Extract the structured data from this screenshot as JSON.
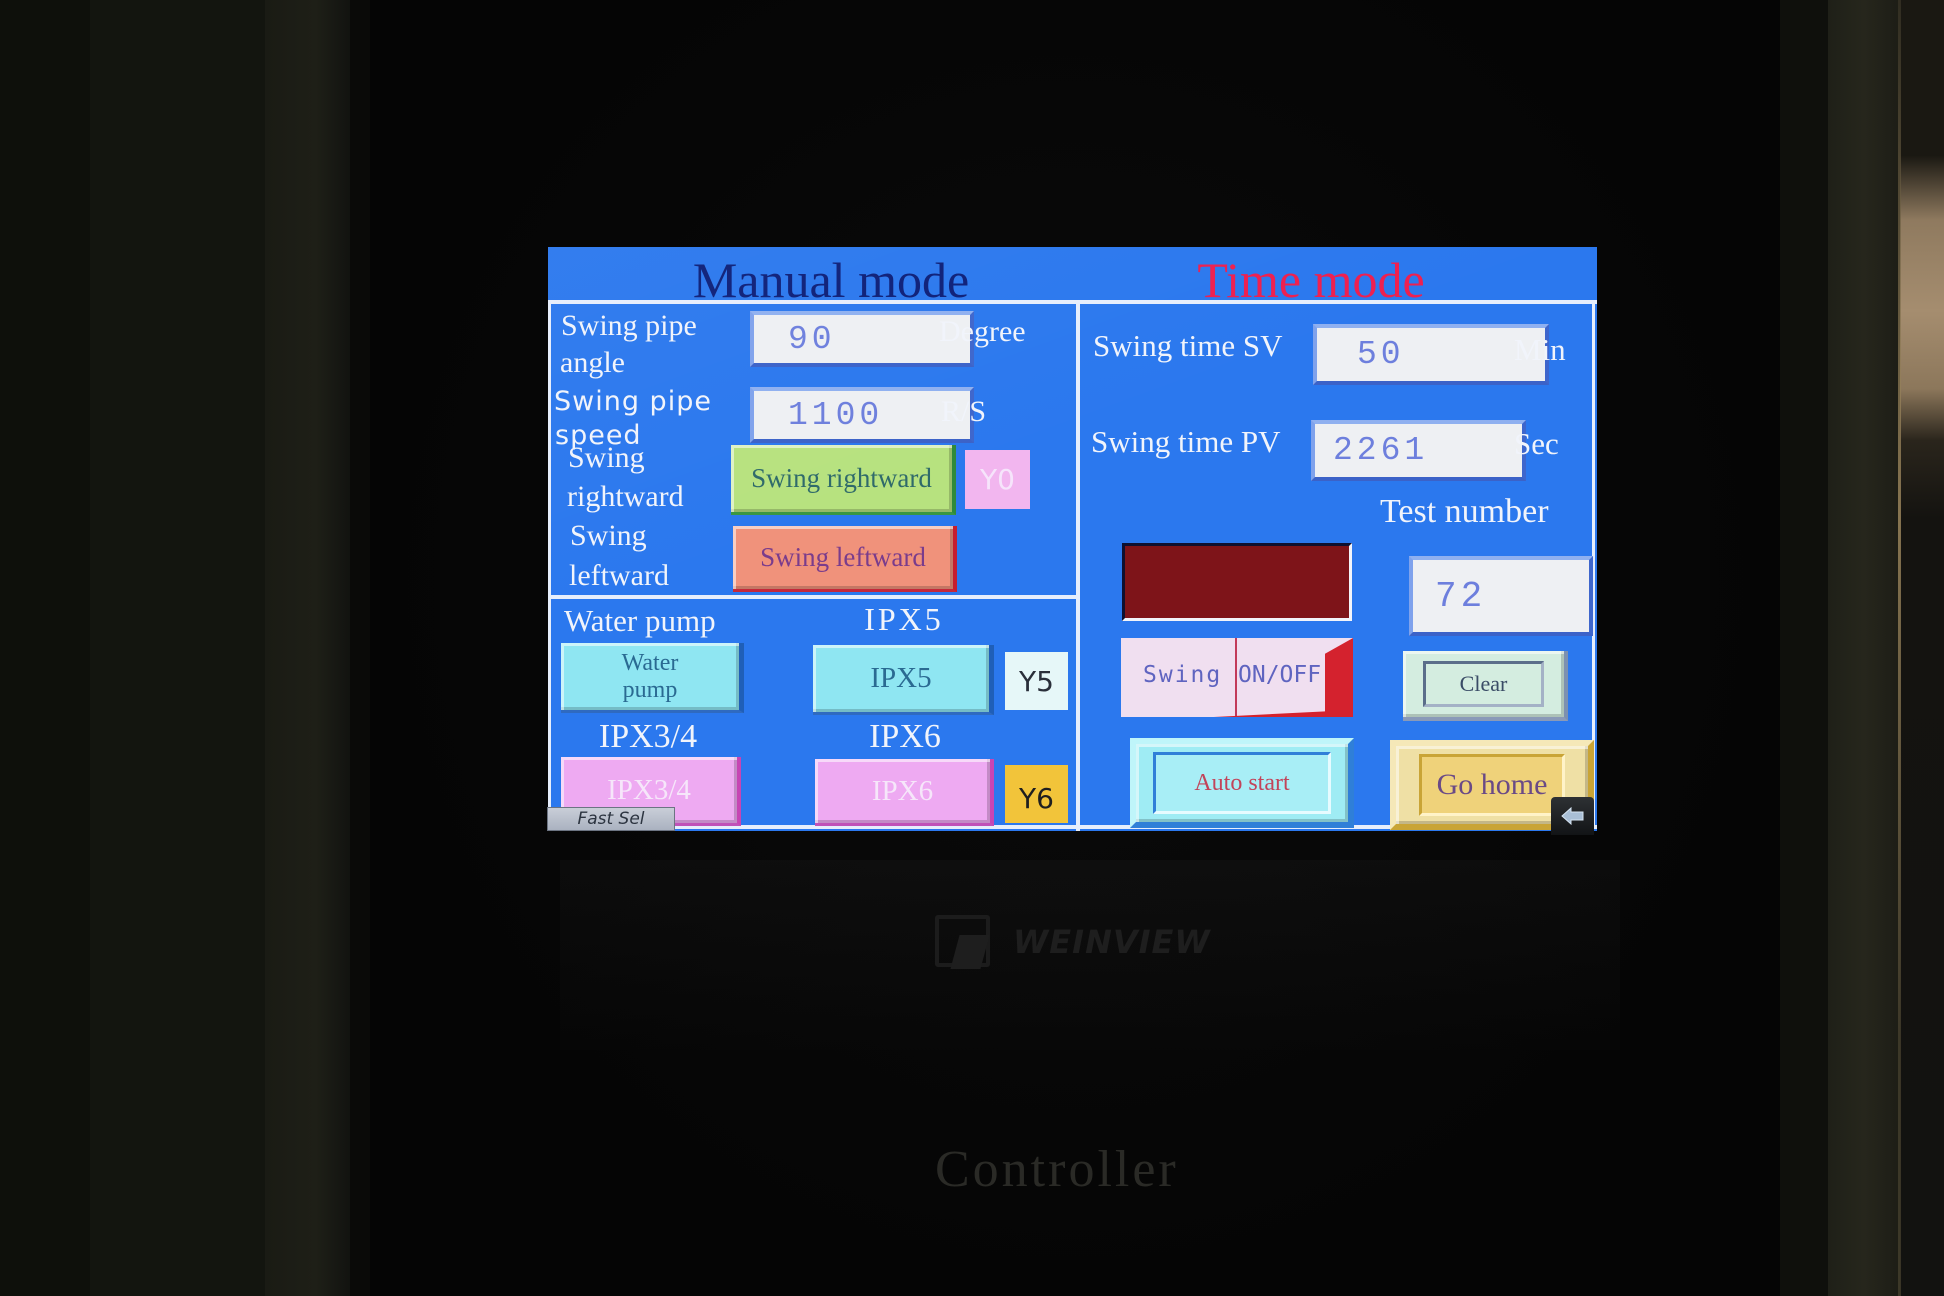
{
  "device": {
    "brand_logo": "WEINVIEW",
    "panel_label": "Controller"
  },
  "colors": {
    "screen_bg": "#2b78ee",
    "manual_title": "#0d1f78",
    "time_title": "#ee1f4f",
    "swing_right_btn": "#b7e27f",
    "swing_left_btn": "#f0927b",
    "indicator_y0": "#f2b6ef",
    "cyan_btn": "#8fe6f2",
    "pink_btn": "#eeaaf2",
    "indicator_y5": "#e6f7f8",
    "indicator_y6": "#f2c43a",
    "alarm_lamp": "#7e1419",
    "go_home_btn": "#efd27a",
    "clear_btn": "#d4ede0"
  },
  "manual_mode": {
    "title": "Manual mode",
    "swing_pipe_angle": {
      "label_line1": "Swing pipe",
      "label_line2": "angle",
      "value": "90",
      "unit": "Degree"
    },
    "swing_pipe_speed": {
      "label_line1": "Swing pipe",
      "label_line2": "speed",
      "value": "1100",
      "unit": "R/S"
    },
    "swing_rightward": {
      "label_line1": "Swing",
      "label_line2": "rightward",
      "button": "Swing rightward",
      "indicator": "Y0"
    },
    "swing_leftward": {
      "label_line1": "Swing",
      "label_line2": "leftward",
      "button": "Swing leftward"
    }
  },
  "outputs": {
    "water_pump": {
      "label": "Water pump",
      "button_line1": "Water",
      "button_line2": "pump"
    },
    "ipx5": {
      "label": "IPX5",
      "button": "IPX5",
      "indicator": "Y5"
    },
    "ipx34": {
      "label": "IPX3/4",
      "button": "IPX3/4"
    },
    "ipx6": {
      "label": "IPX6",
      "button": "IPX6",
      "indicator": "Y6"
    }
  },
  "time_mode": {
    "title": "Time mode",
    "swing_time_sv": {
      "label": "Swing time SV",
      "value": "50",
      "unit": "Min"
    },
    "swing_time_pv": {
      "label": "Swing time PV",
      "value": "2261",
      "unit": "Sec"
    },
    "test_number": {
      "label": "Test number",
      "value": "72"
    },
    "swing_toggle": {
      "left": "Swing",
      "right": "ON/OFF"
    },
    "clear": "Clear",
    "auto_start": "Auto start",
    "go_home": "Go home"
  },
  "system": {
    "fast_sel": "Fast Sel",
    "back_icon": "arrow-left"
  }
}
